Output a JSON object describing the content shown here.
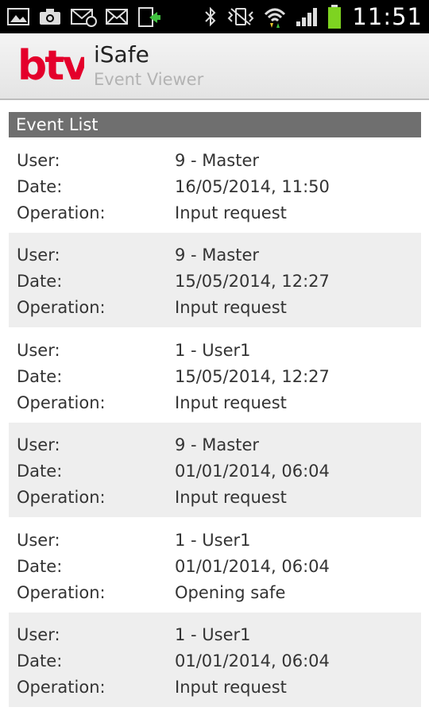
{
  "status_bar": {
    "time": "11:51",
    "left_icons": [
      "gallery-icon",
      "camera-icon",
      "email-sync-icon",
      "email-icon",
      "usb-transfer-icon"
    ],
    "right_icons": [
      "bluetooth-icon",
      "vibrate-icon",
      "wifi-icon",
      "signal-icon",
      "battery-icon"
    ],
    "battery_level": 0.95
  },
  "app": {
    "logo_text": "btv",
    "title": "iSafe",
    "subtitle": "Event Viewer",
    "brand_color": "#e4002b"
  },
  "section": {
    "title": "Event List"
  },
  "labels": {
    "user": "User:",
    "date": "Date:",
    "operation": "Operation:"
  },
  "events": [
    {
      "user": "9 - Master",
      "date": "16/05/2014, 11:50",
      "operation": "Input request"
    },
    {
      "user": "9 - Master",
      "date": "15/05/2014, 12:27",
      "operation": "Input request"
    },
    {
      "user": "1 - User1",
      "date": "15/05/2014, 12:27",
      "operation": "Input request"
    },
    {
      "user": "9 - Master",
      "date": "01/01/2014, 06:04",
      "operation": "Input request"
    },
    {
      "user": "1 - User1",
      "date": "01/01/2014, 06:04",
      "operation": "Opening safe"
    },
    {
      "user": "1 - User1",
      "date": "01/01/2014, 06:04",
      "operation": "Input request"
    }
  ]
}
